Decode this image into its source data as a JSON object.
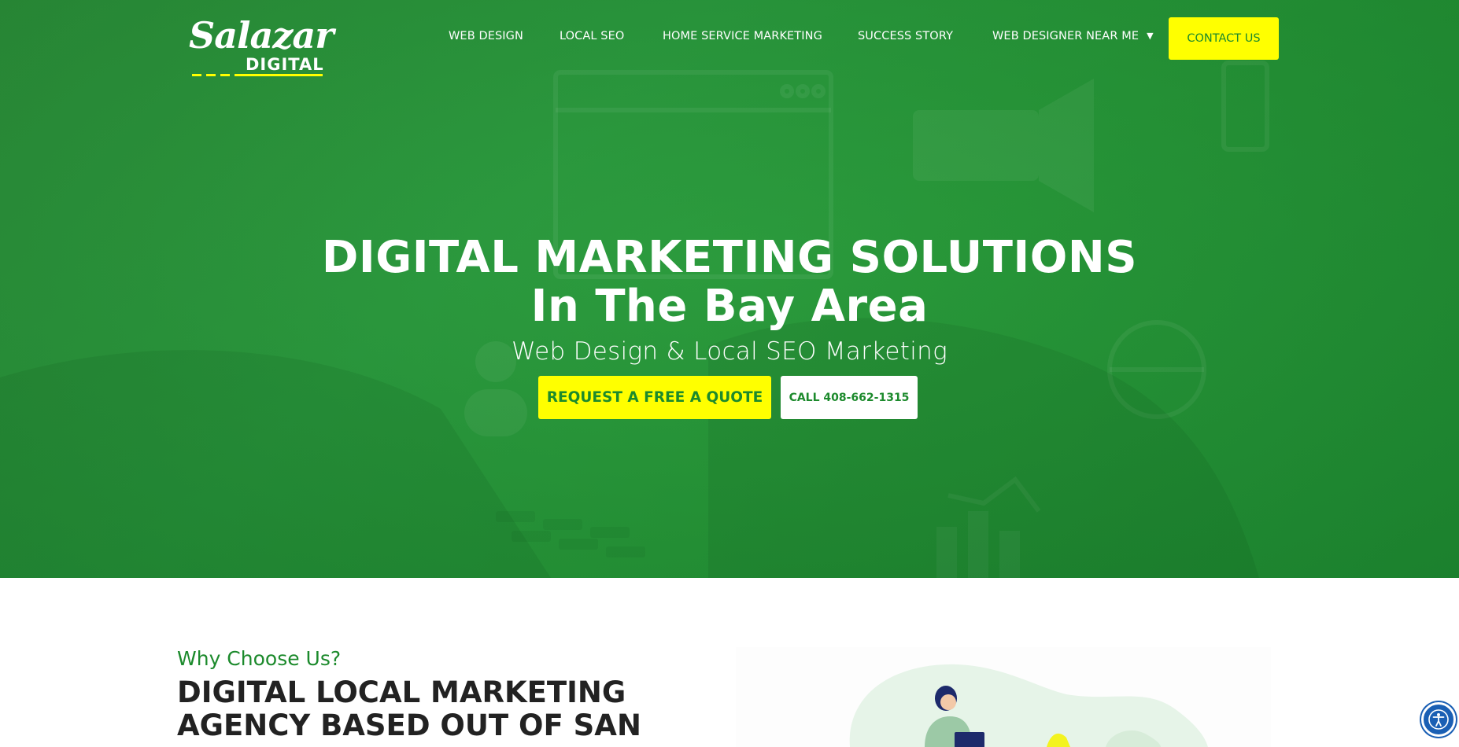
{
  "logo": {
    "script_text": "Salazar",
    "word_text": "DIGITAL"
  },
  "nav": {
    "items": [
      {
        "label": "WEB DESIGN"
      },
      {
        "label": "LOCAL SEO"
      },
      {
        "label": "HOME SERVICE MARKETING"
      },
      {
        "label": "SUCCESS STORY"
      },
      {
        "label": "WEB DESIGNER NEAR ME",
        "has_dropdown": true,
        "icon": "caret-down-icon"
      }
    ],
    "contact_label": "CONTACT US"
  },
  "hero": {
    "title_line1": "DIGITAL MARKETING SOLUTIONS",
    "title_line2": "In The Bay Area",
    "subtitle": "Web Design & Local SEO Marketing",
    "quote_button": "REQUEST A FREE A QUOTE",
    "call_button": "CALL 408-662-1315"
  },
  "section": {
    "kicker": "Why Choose Us?",
    "heading_line1": "DIGITAL LOCAL MARKETING",
    "heading_line2": "AGENCY BASED OUT OF SAN"
  },
  "accessibility": {
    "icon": "accessibility-icon"
  },
  "colors": {
    "brand_green": "#1c8a2c",
    "hero_green": "#2b9a3f",
    "accent_yellow": "#ffff00",
    "heading_dark": "#222222",
    "a11y_blue": "#1a5fb4"
  }
}
